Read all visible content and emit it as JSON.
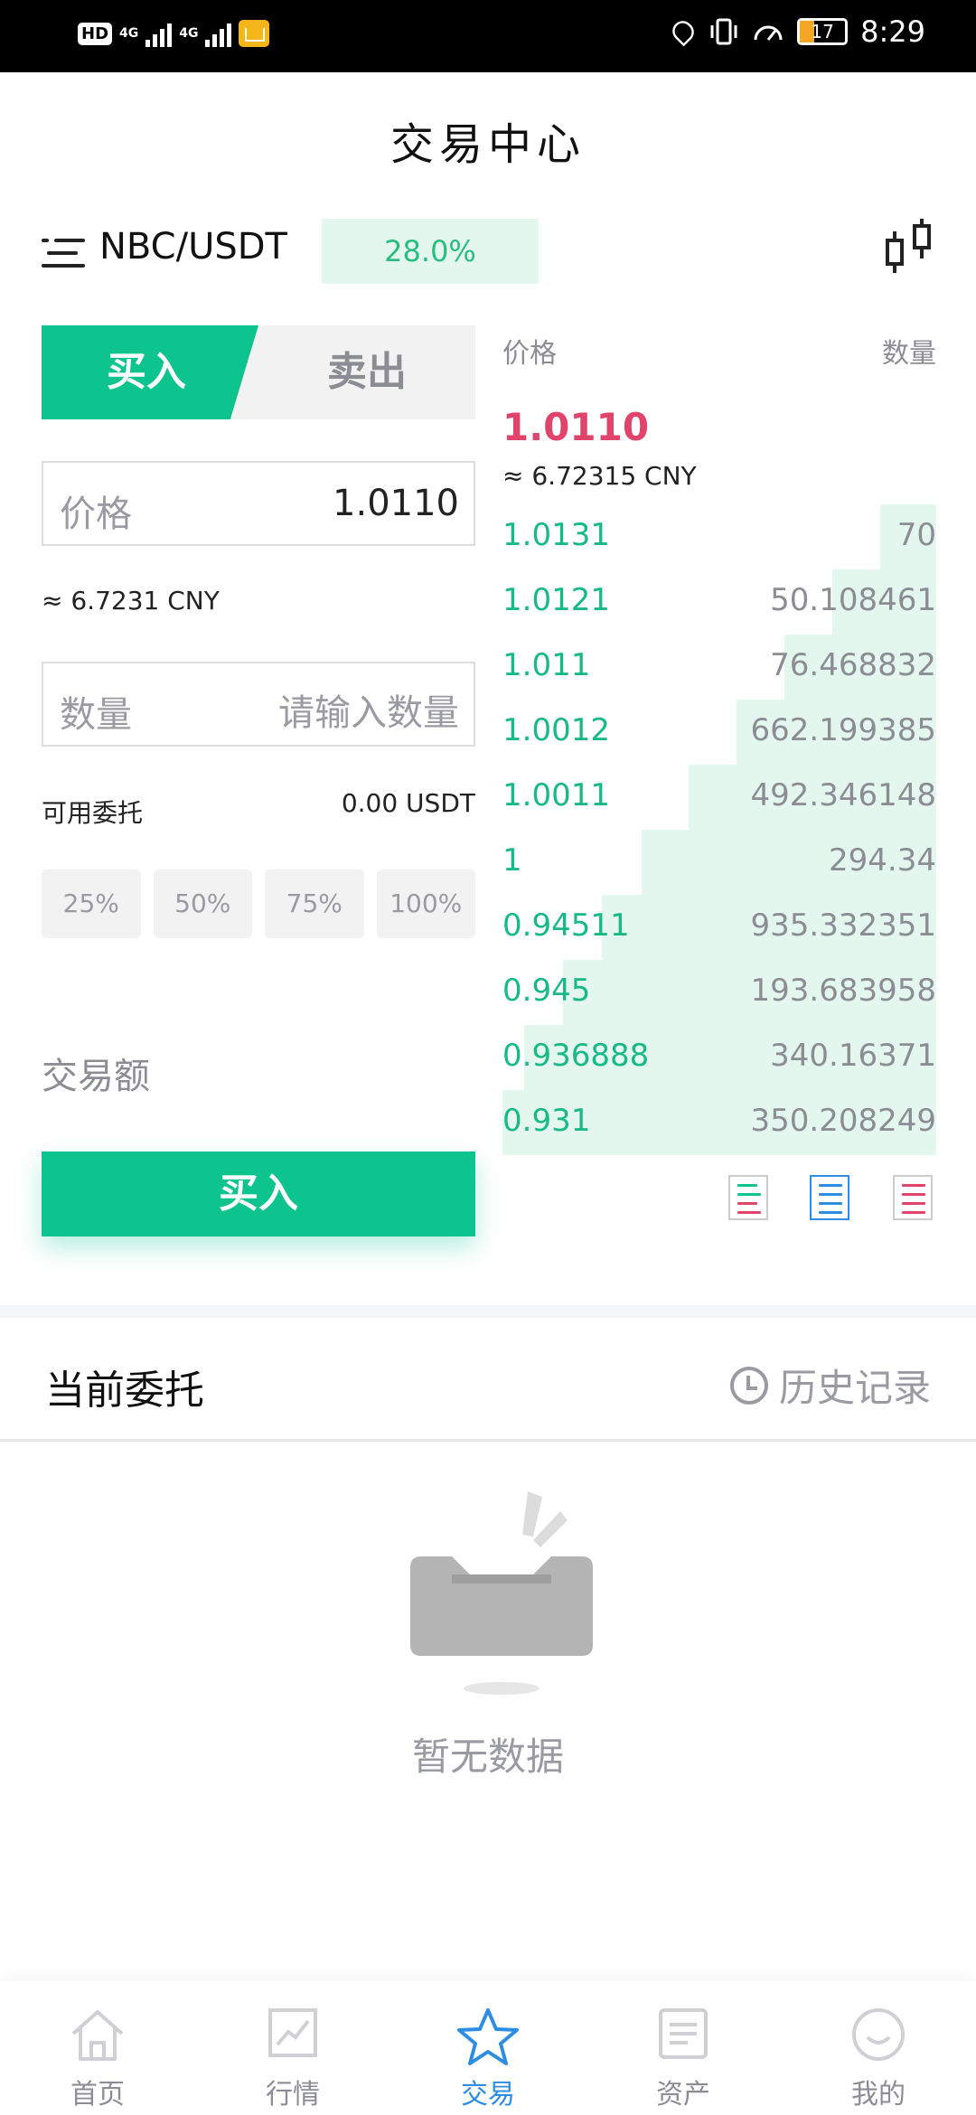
{
  "status_bar": {
    "hd": "HD",
    "network_1": "4G",
    "network_2": "4G",
    "battery": "17",
    "time": "8:29"
  },
  "header": {
    "title": "交易中心"
  },
  "pair": {
    "name": "NBC/USDT",
    "change": "28.0%",
    "menu_icon": "menu-list-icon",
    "chart_icon": "candlestick-icon"
  },
  "order_form": {
    "buy_tab": "买入",
    "sell_tab": "卖出",
    "price_label": "价格",
    "price_value": "1.0110",
    "price_cny": "≈ 6.7231 CNY",
    "qty_label": "数量",
    "qty_placeholder": "请输入数量",
    "available_label": "可用委托",
    "available_value": "0.00 USDT",
    "percents": [
      "25%",
      "50%",
      "75%",
      "100%"
    ],
    "amount_label": "交易额",
    "submit": "买入"
  },
  "order_book": {
    "price_header": "价格",
    "qty_header": "数量",
    "last_price": "1.0110",
    "last_price_cny": "≈ 6.72315 CNY",
    "rows": [
      {
        "price": "1.0131",
        "qty": "70",
        "depth": 0.13
      },
      {
        "price": "1.0121",
        "qty": "50.108461",
        "depth": 0.24
      },
      {
        "price": "1.011",
        "qty": "76.468832",
        "depth": 0.35
      },
      {
        "price": "1.0012",
        "qty": "662.199385",
        "depth": 0.46
      },
      {
        "price": "1.0011",
        "qty": "492.346148",
        "depth": 0.57
      },
      {
        "price": "1",
        "qty": "294.34",
        "depth": 0.68
      },
      {
        "price": "0.94511",
        "qty": "935.332351",
        "depth": 0.77
      },
      {
        "price": "0.945",
        "qty": "193.683958",
        "depth": 0.86
      },
      {
        "price": "0.936888",
        "qty": "340.16371",
        "depth": 0.95
      },
      {
        "price": "0.931",
        "qty": "350.208249",
        "depth": 1.0
      }
    ]
  },
  "orders": {
    "title": "当前委托",
    "history": "历史记录",
    "empty": "暂无数据"
  },
  "bottom_nav": {
    "items": [
      {
        "label": "首页",
        "icon": "home-icon"
      },
      {
        "label": "行情",
        "icon": "market-chart-icon"
      },
      {
        "label": "交易",
        "icon": "star-icon"
      },
      {
        "label": "资产",
        "icon": "assets-icon"
      },
      {
        "label": "我的",
        "icon": "profile-icon"
      }
    ],
    "active": "交易"
  },
  "colors": {
    "accent_green": "#0dc48e",
    "up_green": "#18b987",
    "last_price_red": "#e0446a",
    "nav_active_blue": "#2d8de2"
  }
}
